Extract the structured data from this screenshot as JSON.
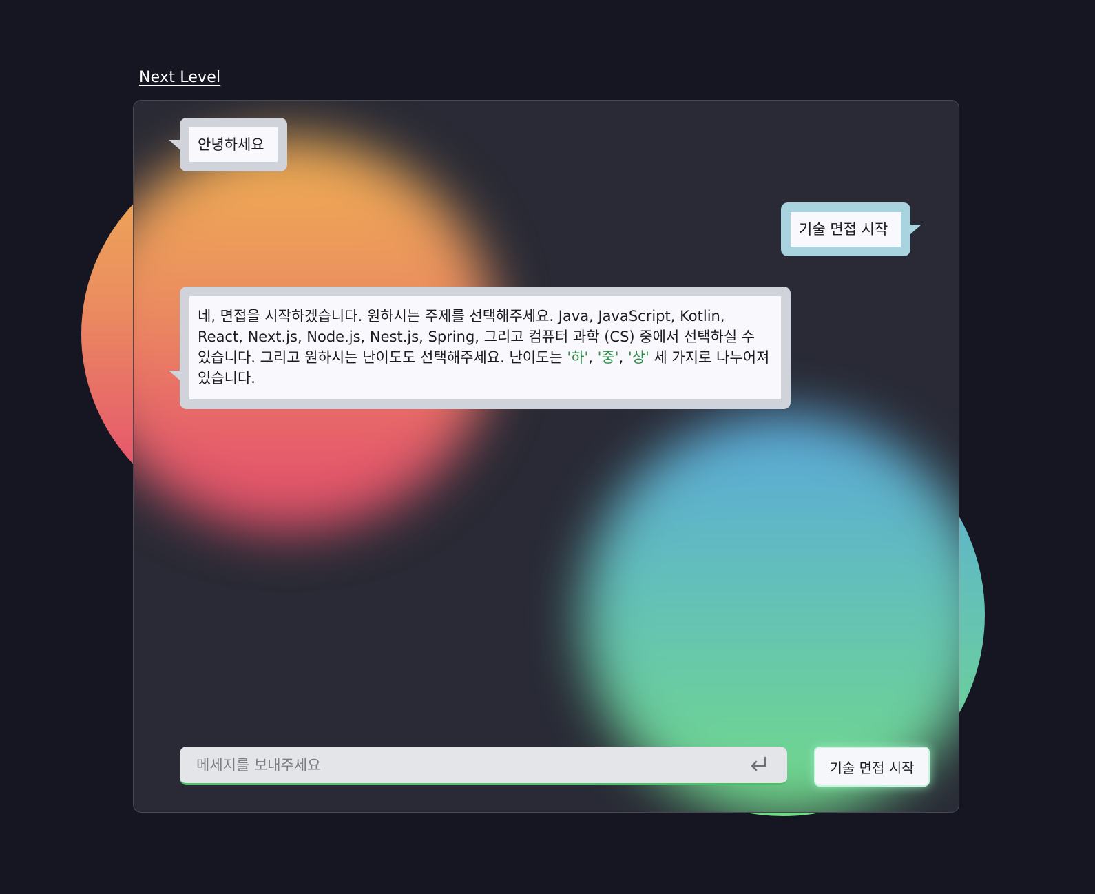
{
  "header": {
    "brand_link": "Next Level"
  },
  "chat": {
    "messages": [
      {
        "role": "bot",
        "text": "안녕하세요"
      },
      {
        "role": "user",
        "text": "기술 면접 시작"
      },
      {
        "role": "bot",
        "text_before": "네, 면접을 시작하겠습니다. 원하시는 주제를 선택해주세요. Java, JavaScript, Kotlin, React, Next.js, Node.js, Nest.js, Spring, 그리고 컴퓨터 과학 (CS) 중에서 선택하실 수 있습니다. 그리고 원하시는 난이도도 선택해주세요. 난이도는 ",
        "levels": [
          "'하'",
          "'중'",
          "'상'"
        ],
        "separator": ", ",
        "text_after": " 세 가지로 나누어져 있습니다."
      }
    ]
  },
  "composer": {
    "placeholder": "메세지를 보내주세요",
    "enter_icon": "enter-return-icon",
    "start_button_label": "기술 면접 시작"
  },
  "colors": {
    "background": "#151621",
    "panel": "#292a35",
    "bot_bubble": "#d1d3da",
    "user_bubble": "#a9d4df",
    "level_highlight": "#2f8e4a",
    "input_accent": "#4cc16a"
  }
}
